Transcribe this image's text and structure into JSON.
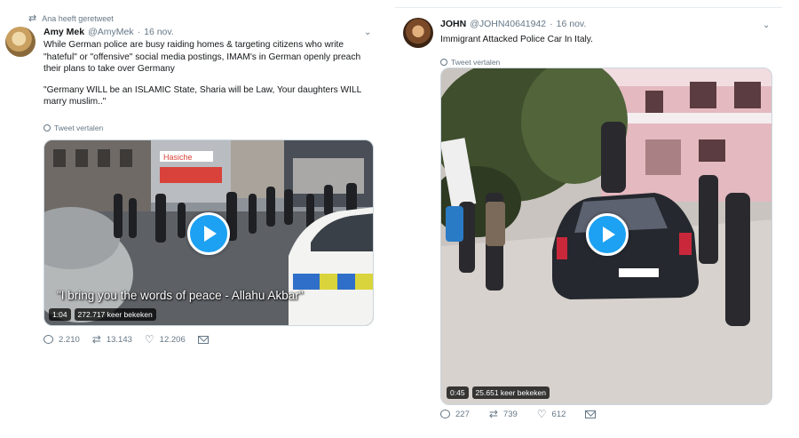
{
  "tweets": [
    {
      "retweeted_by": "Ana heeft geretweet",
      "name": "Amy Mek",
      "handle": "@AmyMek",
      "separator": "·",
      "date": "16 nov.",
      "paragraph1": "While German police are busy raiding homes & targeting citizens who write \"hateful\" or \"offensive\" social media postings, IMAM's in German openly preach their plans to take over Germany",
      "paragraph2": "\"Germany WILL be an ISLAMIC State, Sharia will be Law, Your daughters WILL marry muslim..\"",
      "translate_label": "Tweet vertalen",
      "video": {
        "subtitle": "\"I bring you the words of peace - Allahu Akbar\"",
        "duration": "1:04",
        "views": "272.717 keer bekeken",
        "store_sign": "Hasiche"
      },
      "actions": {
        "replies": "2.210",
        "retweets": "13.143",
        "likes": "12.206"
      }
    },
    {
      "name": "JOHN",
      "handle": "@JOHN40641942",
      "separator": "·",
      "date": "16 nov.",
      "text": "Immigrant Attacked Police Car In Italy.",
      "translate_label": "Tweet vertalen",
      "video": {
        "duration": "0:45",
        "views": "25.651 keer bekeken"
      },
      "actions": {
        "replies": "227",
        "retweets": "739",
        "likes": "612"
      }
    }
  ],
  "icons": {
    "retweet": "retweet-icon",
    "reply": "reply-icon",
    "like": "heart-icon",
    "dm": "mail-icon",
    "more": "chevron-down-icon",
    "translate": "globe-icon",
    "play": "play-icon"
  },
  "colors": {
    "accent": "#1da1f2",
    "muted": "#657786",
    "text": "#14171a"
  }
}
